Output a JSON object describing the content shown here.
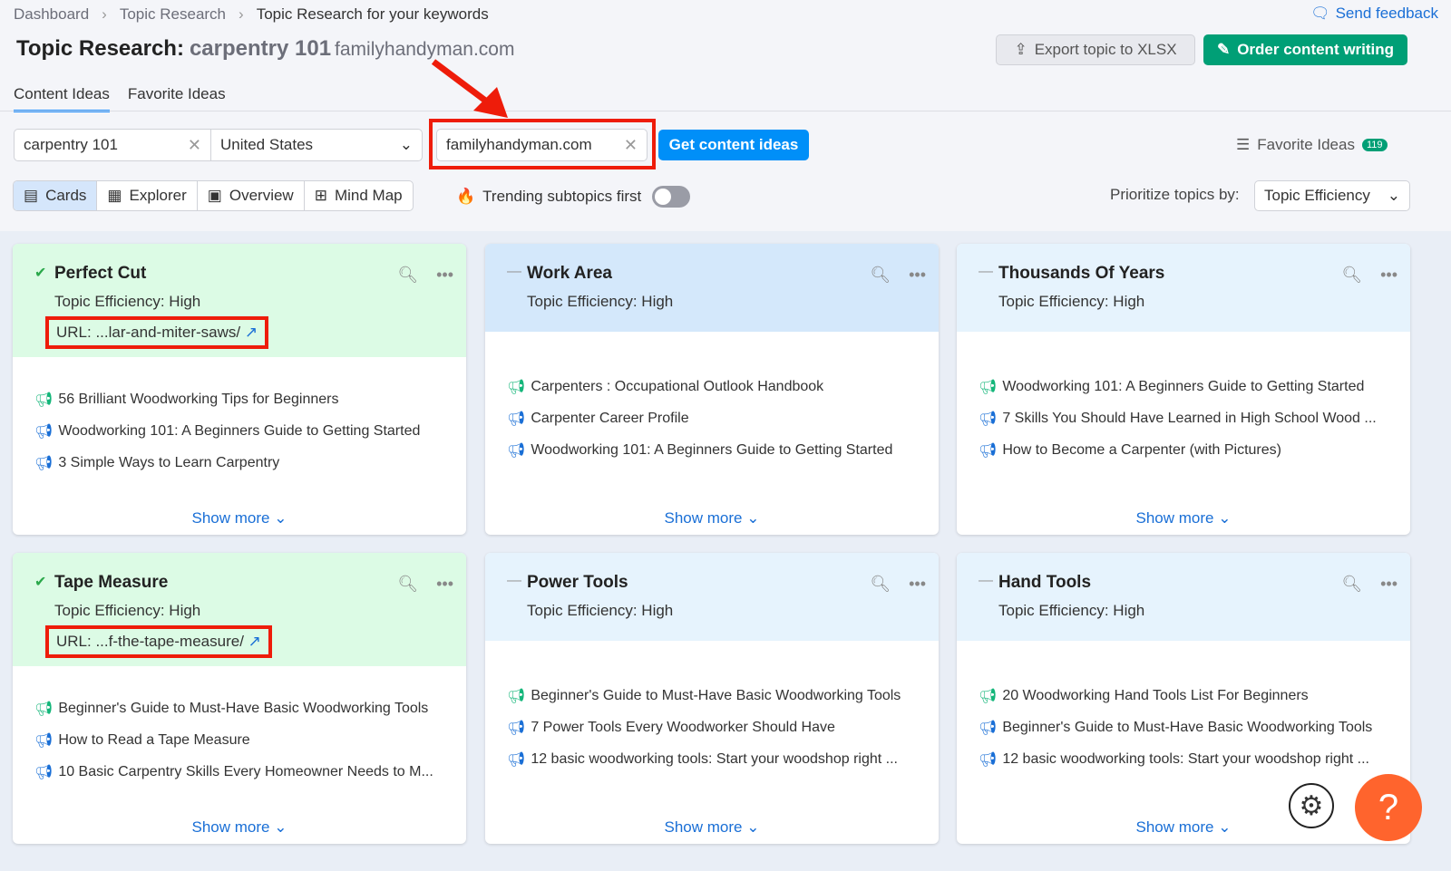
{
  "breadcrumb": [
    "Dashboard",
    "Topic Research",
    "Topic Research for your keywords"
  ],
  "header": {
    "title": "Topic Research:",
    "keyword": "carpentry 101",
    "domain": "familyhandyman.com",
    "send_feedback": "Send feedback",
    "export": "Export topic to XLSX",
    "order": "Order content writing"
  },
  "tabs": [
    {
      "label": "Content Ideas",
      "active": true
    },
    {
      "label": "Favorite Ideas",
      "active": false
    }
  ],
  "search": {
    "keyword": "carpentry 101",
    "country": "United States",
    "domain": "familyhandyman.com",
    "submit": "Get content ideas"
  },
  "favorite": {
    "label": "Favorite Ideas",
    "count": "119"
  },
  "views": [
    {
      "label": "Cards",
      "icon": "cards-icon",
      "active": true
    },
    {
      "label": "Explorer",
      "icon": "table-icon"
    },
    {
      "label": "Overview",
      "icon": "overview-icon"
    },
    {
      "label": "Mind Map",
      "icon": "mindmap-icon"
    }
  ],
  "trending": {
    "label": "Trending subtopics first",
    "on": false
  },
  "prioritize": {
    "label": "Prioritize topics by:",
    "value": "Topic Efficiency"
  },
  "colors": {
    "accent": "#008ff8",
    "brand_green": "#009f76",
    "annotation_red": "#ee1c0a",
    "help": "#ff642d"
  },
  "cards": [
    {
      "title": "Perfect Cut",
      "efficiency": "Topic Efficiency: High",
      "url": "URL: ...lar-and-miter-saws/",
      "status": "check",
      "color": "#dcfbe5",
      "items": [
        {
          "t": "56 Brilliant Woodworking Tips for Beginners",
          "c": "green"
        },
        {
          "t": "Woodworking 101: A Beginners Guide to Getting Started",
          "c": "blue"
        },
        {
          "t": "3 Simple Ways to Learn Carpentry",
          "c": "blue"
        }
      ],
      "more": "Show more"
    },
    {
      "title": "Work Area",
      "efficiency": "Topic Efficiency: High",
      "status": "dash",
      "color": "#d4e8fb",
      "items": [
        {
          "t": "Carpenters : Occupational Outlook Handbook",
          "c": "green"
        },
        {
          "t": "Carpenter Career Profile",
          "c": "blue"
        },
        {
          "t": "Woodworking 101: A Beginners Guide to Getting Started",
          "c": "blue"
        }
      ],
      "more": "Show more"
    },
    {
      "title": "Thousands Of Years",
      "efficiency": "Topic Efficiency: High",
      "status": "dash",
      "color": "#e6f3fd",
      "items": [
        {
          "t": "Woodworking 101: A Beginners Guide to Getting Started",
          "c": "green"
        },
        {
          "t": "7 Skills You Should Have Learned in High School Wood ...",
          "c": "blue"
        },
        {
          "t": "How to Become a Carpenter (with Pictures)",
          "c": "blue"
        }
      ],
      "more": "Show more"
    },
    {
      "title": "Tape Measure",
      "efficiency": "Topic Efficiency: High",
      "url": "URL: ...f-the-tape-measure/",
      "status": "check",
      "color": "#dcfbe5",
      "items": [
        {
          "t": "Beginner's Guide to Must-Have Basic Woodworking Tools",
          "c": "green"
        },
        {
          "t": "How to Read a Tape Measure",
          "c": "blue"
        },
        {
          "t": "10 Basic Carpentry Skills Every Homeowner Needs to M...",
          "c": "blue"
        }
      ],
      "more": "Show more"
    },
    {
      "title": "Power Tools",
      "efficiency": "Topic Efficiency: High",
      "status": "dash",
      "color": "#e6f3fd",
      "items": [
        {
          "t": "Beginner's Guide to Must-Have Basic Woodworking Tools",
          "c": "green"
        },
        {
          "t": "7 Power Tools Every Woodworker Should Have",
          "c": "blue"
        },
        {
          "t": "12 basic woodworking tools: Start your woodshop right ...",
          "c": "blue"
        }
      ],
      "more": "Show more"
    },
    {
      "title": "Hand Tools",
      "efficiency": "Topic Efficiency: High",
      "status": "dash",
      "color": "#e6f3fd",
      "items": [
        {
          "t": "20 Woodworking Hand Tools List For Beginners",
          "c": "green"
        },
        {
          "t": "Beginner's Guide to Must-Have Basic Woodworking Tools",
          "c": "blue"
        },
        {
          "t": "12 basic woodworking tools: Start your woodshop right ...",
          "c": "blue"
        }
      ],
      "more": "Show more"
    }
  ]
}
